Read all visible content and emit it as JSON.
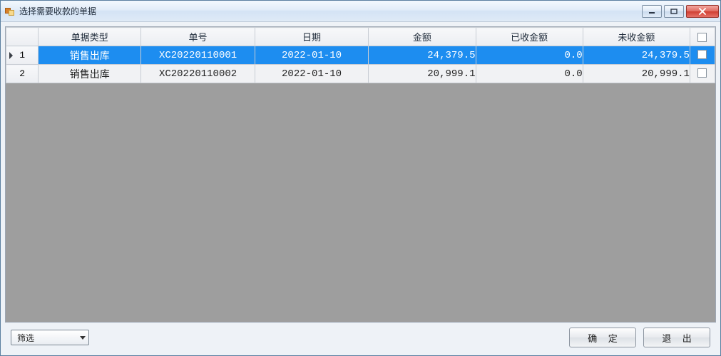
{
  "window": {
    "title": "选择需要收款的单据"
  },
  "grid": {
    "columns": {
      "type": "单据类型",
      "no": "单号",
      "date": "日期",
      "amount": "金额",
      "received": "已收金额",
      "unreceived": "未收金额"
    },
    "rows": [
      {
        "idx": "1",
        "type": "销售出库",
        "no": "XC20220110001",
        "date": "2022-01-10",
        "amount": "24,379.5",
        "received": "0.0",
        "unreceived": "24,379.5",
        "selected": true,
        "checked": false
      },
      {
        "idx": "2",
        "type": "销售出库",
        "no": "XC20220110002",
        "date": "2022-01-10",
        "amount": "20,999.1",
        "received": "0.0",
        "unreceived": "20,999.1",
        "selected": false,
        "checked": false
      }
    ]
  },
  "footer": {
    "filter_label": "筛选",
    "ok_label": "确 定",
    "exit_label": "退 出"
  }
}
